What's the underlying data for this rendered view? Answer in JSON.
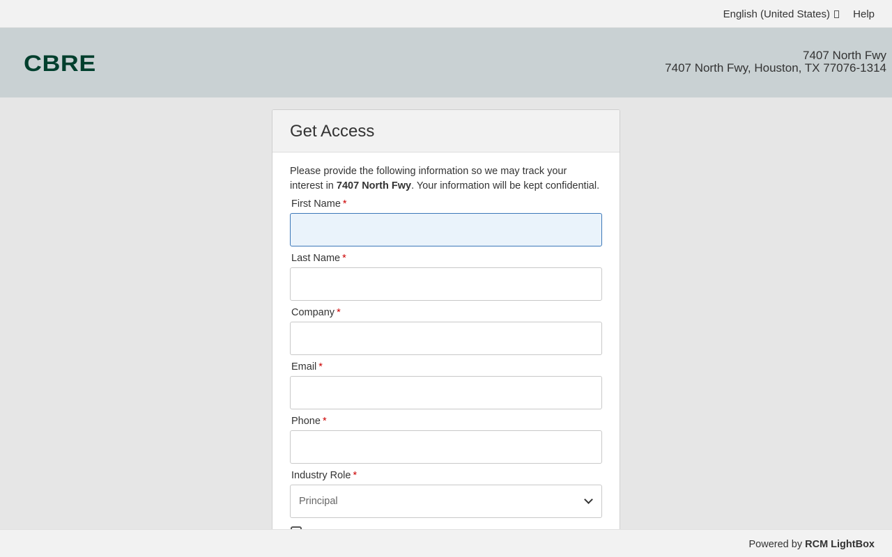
{
  "topbar": {
    "language": "English (United States)",
    "help": "Help"
  },
  "header": {
    "logo": "CBRE",
    "address_line1": "7407 North Fwy",
    "address_line2": "7407 North Fwy, Houston, TX 77076-1314"
  },
  "card": {
    "title": "Get Access",
    "intro_prefix": "Please provide the following information so we may track your interest in ",
    "intro_property": "7407 North Fwy",
    "intro_suffix": ". Your information will be kept confidential.",
    "required_marker": "*",
    "fields": [
      {
        "label": "First Name",
        "value": ""
      },
      {
        "label": "Last Name",
        "value": ""
      },
      {
        "label": "Company",
        "value": ""
      },
      {
        "label": "Email",
        "value": ""
      },
      {
        "label": "Phone",
        "value": ""
      }
    ],
    "industry_role": {
      "label": "Industry Role",
      "selected": "Principal"
    }
  },
  "footer": {
    "powered_prefix": "Powered by ",
    "powered_brand": "RCM LightBox"
  }
}
